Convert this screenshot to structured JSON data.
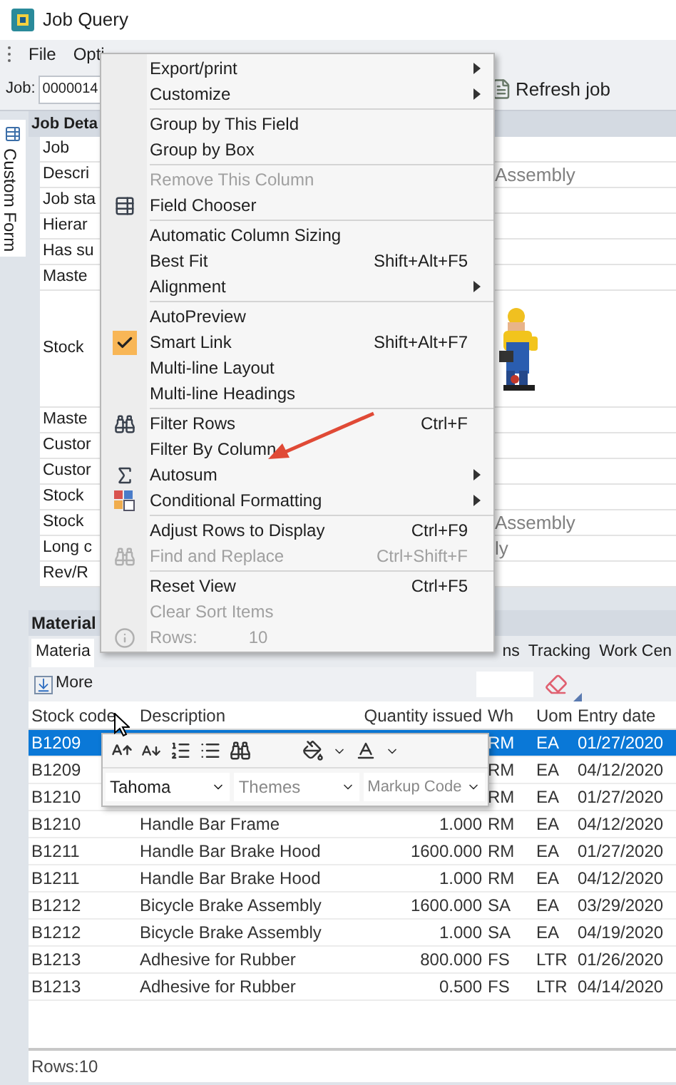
{
  "window": {
    "title": "Job Query"
  },
  "menu_bar": [
    {
      "label": "File"
    },
    {
      "label": "Opti"
    }
  ],
  "toolbar": {
    "job_label": "Job:",
    "job_value": "0000014",
    "refresh_button": "Refresh job"
  },
  "side_tab": {
    "label": "Custom Form",
    "selected": true
  },
  "job_details": {
    "title": "Job Deta",
    "rows": [
      {
        "label": "Job"
      },
      {
        "label": "Descri",
        "value": "Assembly"
      },
      {
        "label": "Job sta"
      },
      {
        "label": "Hierar"
      },
      {
        "label": "Has su"
      },
      {
        "label": "Maste"
      },
      {
        "label": "Stock",
        "kind": "picture"
      },
      {
        "label": "Maste"
      },
      {
        "label": "Custor"
      },
      {
        "label": "Custor"
      },
      {
        "label": "Stock"
      },
      {
        "label": "Stock",
        "value": "Assembly"
      },
      {
        "label": "Long c",
        "value": "ly"
      },
      {
        "label": "Rev/R"
      }
    ]
  },
  "materials": {
    "title": "Material",
    "tabs": [
      {
        "label": "Materia",
        "selected": true
      },
      {
        "label": "ns",
        "selected": false
      },
      {
        "label": "Tracking",
        "selected": false
      },
      {
        "label": "Work Cen",
        "selected": false
      }
    ],
    "more_button": "More",
    "columns": {
      "stock_code": "Stock code",
      "description": "Description",
      "quantity": "Quantity issued",
      "wh": "Wh",
      "uom": "Uom",
      "entry_date": "Entry date"
    },
    "rows": [
      {
        "stock_code": "B1209",
        "wh": "RM",
        "uom": "EA",
        "entry_date": "01/27/2020",
        "selected": true
      },
      {
        "stock_code": "B1209",
        "wh": "RM",
        "uom": "EA",
        "entry_date": "04/12/2020",
        "selected": false
      },
      {
        "stock_code": "B1210",
        "wh": "RM",
        "uom": "EA",
        "entry_date": "01/27/2020",
        "selected": false
      },
      {
        "stock_code": "B1210",
        "description": "Handle Bar Frame",
        "quantity": "1.000",
        "wh": "RM",
        "uom": "EA",
        "entry_date": "04/12/2020",
        "selected": false
      },
      {
        "stock_code": "B1211",
        "description": "Handle Bar Brake Hood",
        "quantity": "1600.000",
        "wh": "RM",
        "uom": "EA",
        "entry_date": "01/27/2020",
        "selected": false
      },
      {
        "stock_code": "B1211",
        "description": "Handle Bar Brake Hood",
        "quantity": "1.000",
        "wh": "RM",
        "uom": "EA",
        "entry_date": "04/12/2020",
        "selected": false
      },
      {
        "stock_code": "B1212",
        "description": "Bicycle Brake Assembly",
        "quantity": "1600.000",
        "wh": "SA",
        "uom": "EA",
        "entry_date": "03/29/2020",
        "selected": false
      },
      {
        "stock_code": "B1212",
        "description": "Bicycle Brake Assembly",
        "quantity": "1.000",
        "wh": "SA",
        "uom": "EA",
        "entry_date": "04/19/2020",
        "selected": false
      },
      {
        "stock_code": "B1213",
        "description": "Adhesive for Rubber",
        "quantity": "800.000",
        "wh": "FS",
        "uom": "LTR",
        "entry_date": "01/26/2020",
        "selected": false
      },
      {
        "stock_code": "B1213",
        "description": "Adhesive for Rubber",
        "quantity": "0.500",
        "wh": "FS",
        "uom": "LTR",
        "entry_date": "04/14/2020",
        "selected": false
      }
    ],
    "status": "Rows:10"
  },
  "context_menu": {
    "groups": [
      {
        "items": [
          {
            "label": "Export/print",
            "submenu": true,
            "disabled": false,
            "checked": false
          },
          {
            "label": "Customize",
            "submenu": true,
            "disabled": false,
            "checked": false
          }
        ]
      },
      {
        "items": [
          {
            "label": "Group by This Field",
            "submenu": false,
            "disabled": false,
            "checked": false
          },
          {
            "label": "Group by Box",
            "submenu": false,
            "disabled": false,
            "checked": false
          }
        ]
      },
      {
        "items": [
          {
            "label": "Remove This Column",
            "submenu": false,
            "disabled": true,
            "checked": false
          },
          {
            "label": "Field Chooser",
            "submenu": false,
            "disabled": false,
            "checked": false
          }
        ]
      },
      {
        "items": [
          {
            "label": "Automatic Column Sizing",
            "submenu": false,
            "disabled": false,
            "checked": false
          },
          {
            "label": "Best Fit",
            "shortcut": "Shift+Alt+F5",
            "submenu": false,
            "disabled": false,
            "checked": false
          },
          {
            "label": "Alignment",
            "submenu": true,
            "disabled": false,
            "checked": false
          }
        ]
      },
      {
        "items": [
          {
            "label": "AutoPreview",
            "submenu": false,
            "disabled": false,
            "checked": false
          },
          {
            "label": "Smart Link",
            "shortcut": "Shift+Alt+F7",
            "submenu": false,
            "disabled": false,
            "checked": true
          },
          {
            "label": "Multi-line Layout",
            "submenu": false,
            "disabled": false,
            "checked": false
          },
          {
            "label": "Multi-line Headings",
            "submenu": false,
            "disabled": false,
            "checked": false
          }
        ]
      },
      {
        "items": [
          {
            "label": "Filter Rows",
            "shortcut": "Ctrl+F",
            "submenu": false,
            "disabled": false,
            "checked": false
          },
          {
            "label": "Filter By Column",
            "submenu": false,
            "disabled": false,
            "checked": false
          },
          {
            "label": "Autosum",
            "submenu": true,
            "disabled": false,
            "checked": false
          },
          {
            "label": "Conditional Formatting",
            "submenu": true,
            "disabled": false,
            "checked": false
          }
        ]
      },
      {
        "items": [
          {
            "label": "Adjust Rows to Display",
            "shortcut": "Ctrl+F9",
            "submenu": false,
            "disabled": false,
            "checked": false
          },
          {
            "label": "Find and Replace",
            "shortcut": "Ctrl+Shift+F",
            "submenu": false,
            "disabled": true,
            "checked": false
          }
        ]
      },
      {
        "items": [
          {
            "label": "Reset View",
            "shortcut": "Ctrl+F5",
            "submenu": false,
            "disabled": false,
            "checked": false
          },
          {
            "label": "Clear Sort Items",
            "submenu": false,
            "disabled": true,
            "checked": false
          },
          {
            "label": "Rows:",
            "value": "10",
            "submenu": false,
            "disabled": true,
            "checked": false
          }
        ]
      }
    ]
  },
  "mini_toolbar": {
    "font": "Tahoma",
    "themes_placeholder": "Themes",
    "markup_placeholder": "Markup Code"
  }
}
